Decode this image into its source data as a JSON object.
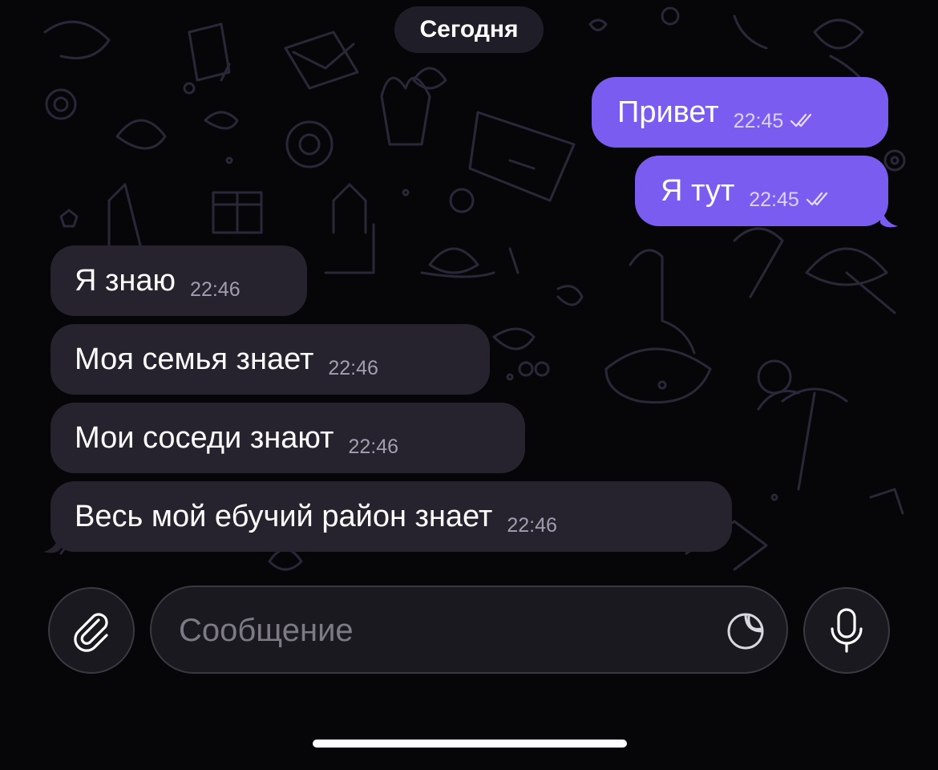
{
  "chat": {
    "date_label": "Сегодня",
    "messages": [
      {
        "direction": "outgoing",
        "text": "Привет",
        "time": "22:45",
        "status": "read"
      },
      {
        "direction": "outgoing",
        "text": "Я тут",
        "time": "22:45",
        "status": "read"
      },
      {
        "direction": "incoming",
        "text": "Я знаю",
        "time": "22:46"
      },
      {
        "direction": "incoming",
        "text": "Моя семья знает",
        "time": "22:46"
      },
      {
        "direction": "incoming",
        "text": "Мои соседи знают",
        "time": "22:46"
      },
      {
        "direction": "incoming",
        "text": "Весь мой ебучий район знает",
        "time": "22:46"
      }
    ]
  },
  "composer": {
    "placeholder": "Сообщение",
    "attach_icon": "paperclip-icon",
    "sticker_icon": "sticker-icon",
    "mic_icon": "microphone-icon"
  },
  "colors": {
    "outgoing_bubble": "#7b5cf0",
    "incoming_bubble": "#26232f",
    "background": "#060608"
  }
}
